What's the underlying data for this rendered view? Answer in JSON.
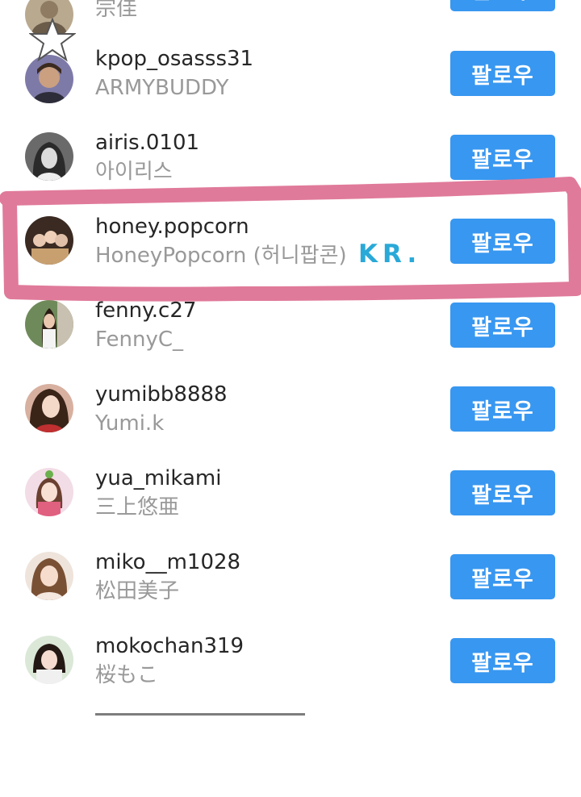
{
  "follow_label": "팔로우",
  "watermark_text": "KR.",
  "accent_color": "#3897f0",
  "highlight_color": "#e07a9a",
  "rows": [
    {
      "username": "",
      "fullname": "宗佳",
      "avatar_color": "#b9a98f"
    },
    {
      "username": "kpop_osasss31",
      "fullname": "ARMYBUDDY",
      "avatar_color": "#7e7aa8"
    },
    {
      "username": "airis.0101",
      "fullname": "아이리스",
      "avatar_color": "#555555"
    },
    {
      "username": "honey.popcorn",
      "fullname": "HoneyPopcorn (허니팝콘)",
      "avatar_color": "#6e4a3a"
    },
    {
      "username": "fenny.c27",
      "fullname": "FennyC_",
      "avatar_color": "#8a7a6a"
    },
    {
      "username": "yumibb8888",
      "fullname": "Yumi.k",
      "avatar_color": "#c49080"
    },
    {
      "username": "yua_mikami",
      "fullname": "三上悠亜",
      "avatar_color": "#e6b8c8"
    },
    {
      "username": "miko__m1028",
      "fullname": "松田美子",
      "avatar_color": "#d8b8a8"
    },
    {
      "username": "mokochan319",
      "fullname": "桜もこ",
      "avatar_color": "#b8a8a0"
    }
  ],
  "icons": [
    "star-icon",
    "avatar-image"
  ]
}
